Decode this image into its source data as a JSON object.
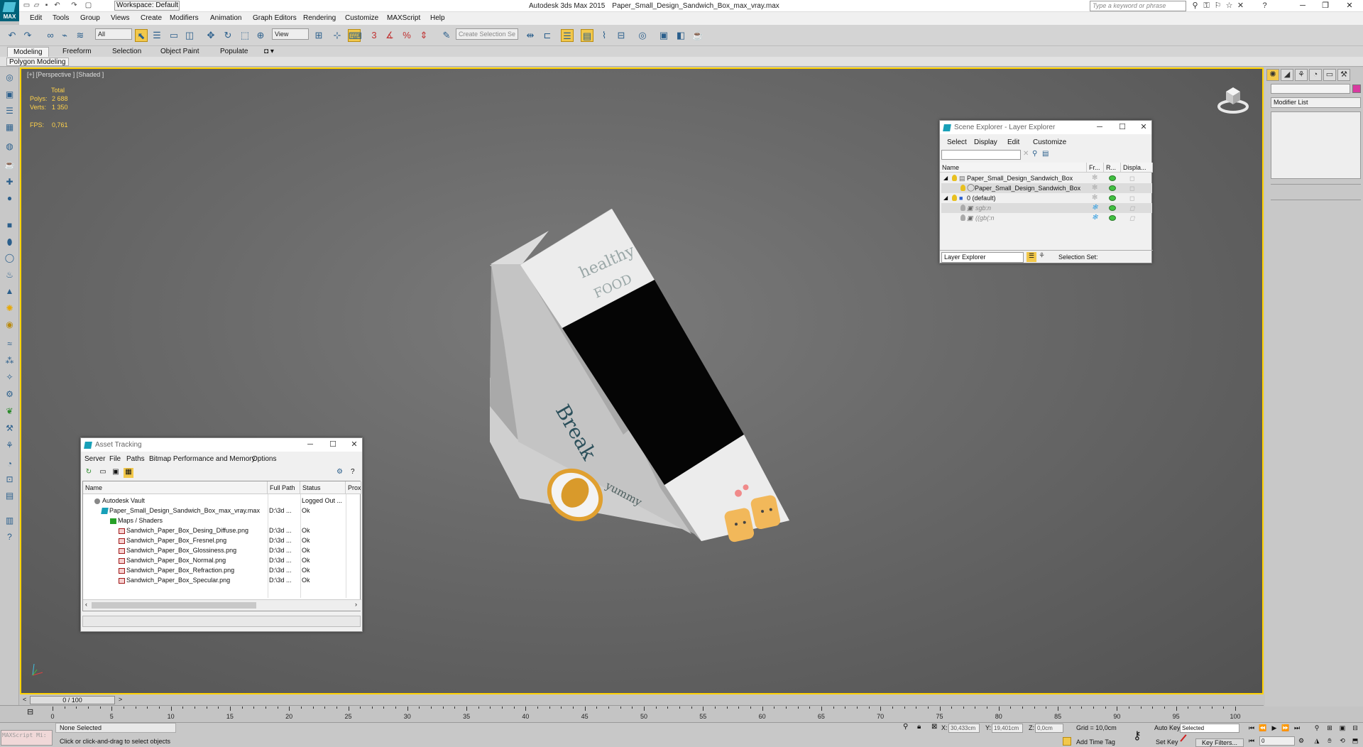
{
  "app": {
    "logo_text": "MAX",
    "title": "Autodesk 3ds Max  2015",
    "file": "Paper_Small_Design_Sandwich_Box_max_vray.max",
    "search_placeholder": "Type a keyword or phrase",
    "workspace": "Workspace: Default"
  },
  "menu": [
    "Edit",
    "Tools",
    "Group",
    "Views",
    "Create",
    "Modifiers",
    "Animation",
    "Graph Editors",
    "Rendering",
    "Customize",
    "MAXScript",
    "Help"
  ],
  "toolbar": {
    "filter": "All",
    "ref_coord": "View",
    "selection_set": "Create Selection Se"
  },
  "ribbon": {
    "tabs": [
      "Modeling",
      "Freeform",
      "Selection",
      "Object Paint",
      "Populate"
    ],
    "panel": "Polygon Modeling"
  },
  "viewport": {
    "label": "[+] [Perspective ] [Shaded ]",
    "stats_header": "Total",
    "polys_label": "Polys:",
    "polys_value": "2 688",
    "verts_label": "Verts:",
    "verts_value": "1 350",
    "fps_label": "FPS:",
    "fps_value": "0,761"
  },
  "command_panel": {
    "modifier_list": "Modifier List"
  },
  "asset_tracking": {
    "title": "Asset Tracking",
    "menu": [
      "Server",
      "File",
      "Paths",
      "Bitmap Performance and Memory",
      "Options"
    ],
    "columns": [
      "Name",
      "Full Path",
      "Status",
      "Prox"
    ],
    "rows": [
      {
        "name": "Autodesk Vault",
        "path": "",
        "status": "Logged Out ..."
      },
      {
        "name": "Paper_Small_Design_Sandwich_Box_max_vray.max",
        "path": "D:\\3d ...",
        "status": "Ok"
      },
      {
        "name": "Maps / Shaders",
        "path": "",
        "status": ""
      },
      {
        "name": "Sandwich_Paper_Box_Desing_Diffuse.png",
        "path": "D:\\3d ...",
        "status": "Ok"
      },
      {
        "name": "Sandwich_Paper_Box_Fresnel.png",
        "path": "D:\\3d ...",
        "status": "Ok"
      },
      {
        "name": "Sandwich_Paper_Box_Glossiness.png",
        "path": "D:\\3d ...",
        "status": "Ok"
      },
      {
        "name": "Sandwich_Paper_Box_Normal.png",
        "path": "D:\\3d ...",
        "status": "Ok"
      },
      {
        "name": "Sandwich_Paper_Box_Refraction.png",
        "path": "D:\\3d ...",
        "status": "Ok"
      },
      {
        "name": "Sandwich_Paper_Box_Specular.png",
        "path": "D:\\3d ...",
        "status": "Ok"
      }
    ]
  },
  "scene_explorer": {
    "title": "Scene Explorer - Layer Explorer",
    "menu": [
      "Select",
      "Display",
      "Edit",
      "Customize"
    ],
    "columns": [
      "Name",
      "Fr...",
      "R...",
      "Displa..."
    ],
    "rows": [
      {
        "name": "Paper_Small_Design_Sandwich_Box"
      },
      {
        "name": "Paper_Small_Design_Sandwich_Box"
      },
      {
        "name": "0 (default)"
      },
      {
        "name": "sgb:n"
      },
      {
        "name": "((gb(:n"
      }
    ],
    "mode": "Layer Explorer",
    "selection_set": "Selection Set:"
  },
  "timeline": {
    "slider": "0 / 100",
    "ticks": [
      0,
      5,
      10,
      15,
      20,
      25,
      30,
      35,
      40,
      45,
      50,
      55,
      60,
      65,
      70,
      75,
      80,
      85,
      90,
      95,
      100
    ]
  },
  "status": {
    "maxscript": "MAXScript Mi:",
    "selection": "None Selected",
    "prompt": "Click or click-and-drag to select objects",
    "x_label": "X:",
    "x_value": "30,433cm",
    "y_label": "Y:",
    "y_value": "19,401cm",
    "z_label": "Z:",
    "z_value": "0,0cm",
    "grid": "Grid = 10,0cm",
    "add_time_tag": "Add Time Tag",
    "auto_key": "Auto Key",
    "set_key": "Set Key",
    "key_mode": "Selected",
    "key_filters": "Key Filters...",
    "frame": "0"
  },
  "colors": {
    "accent": "#ffd200",
    "viewport_bg": "#6a6a6a",
    "stats_text": "#ffd24a"
  }
}
